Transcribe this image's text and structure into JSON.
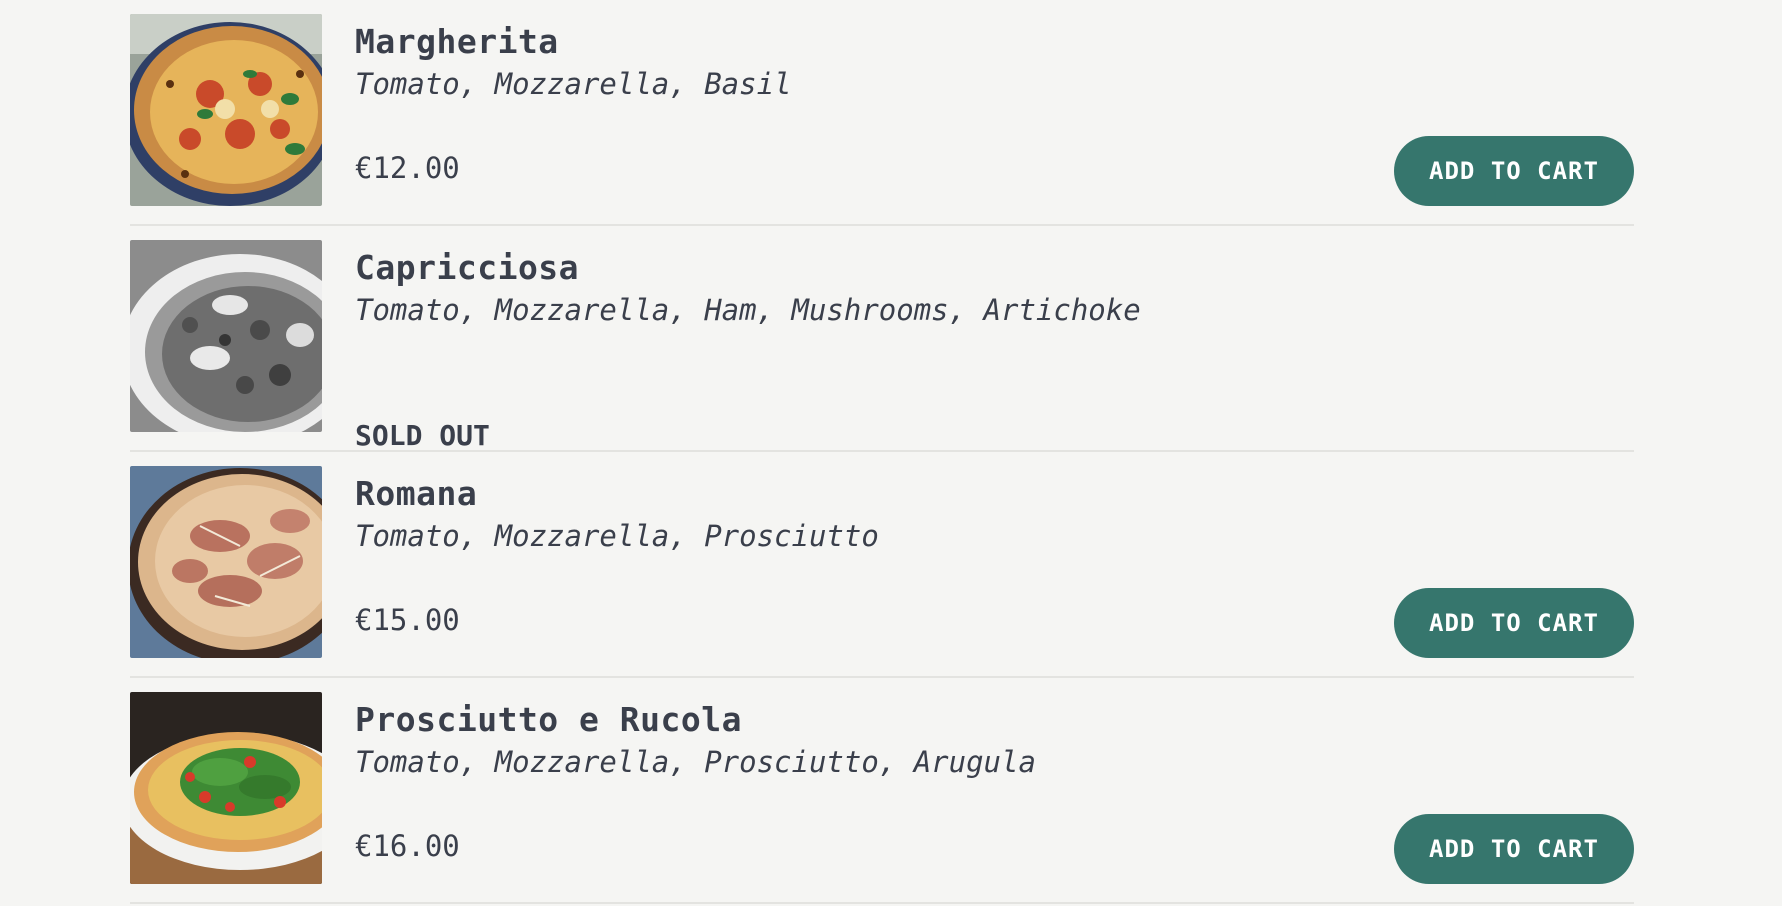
{
  "items": [
    {
      "name": "Margherita",
      "ingredients": "Tomato, Mozzarella, Basil",
      "price": "€12.00",
      "sold_out": false,
      "button_label": "ADD TO CART"
    },
    {
      "name": "Capricciosa",
      "ingredients": "Tomato, Mozzarella, Ham, Mushrooms, Artichoke",
      "status": "SOLD OUT",
      "sold_out": true
    },
    {
      "name": "Romana",
      "ingredients": "Tomato, Mozzarella, Prosciutto",
      "price": "€15.00",
      "sold_out": false,
      "button_label": "ADD TO CART"
    },
    {
      "name": "Prosciutto e Rucola",
      "ingredients": "Tomato, Mozzarella, Prosciutto, Arugula",
      "price": "€16.00",
      "sold_out": false,
      "button_label": "ADD TO CART"
    }
  ],
  "colors": {
    "accent": "#36766d",
    "text": "#3a3f4b",
    "background": "#f5f5f3"
  }
}
